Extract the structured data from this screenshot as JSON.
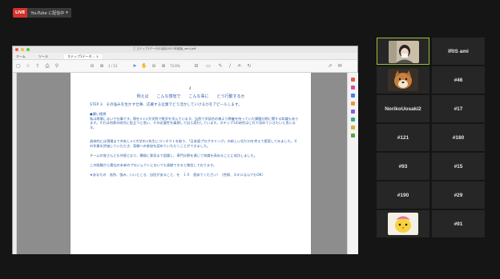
{
  "live_badge": {
    "label": "LIVE",
    "text": "YouTube に配信中",
    "caret": "▾"
  },
  "window": {
    "title": "□ ステップ1データの活用/2023年度版_ver4.pdf",
    "tabs": [
      "ホーム",
      "ツール",
      "ステップ1データ… ×"
    ],
    "page_indicator": "1 / 12",
    "zoom": "73.6%"
  },
  "document": {
    "page_mark": "4",
    "heading": "例えば　　こんな感覚で　　こんな事に　　どう行動するか",
    "step_line": "STEP 3　その強みを生かす仕事、応募する企業でどう活かしていけるかをアピールします。",
    "paragraph1": "●課い理想\n私は現場しないで仕事です。現在×××大学院で数学を学んでいます。当然で学部名の様より教養を持っていた課題分野に関する知識もあります。それは何県の研究に役立つと思い、その必要性を痛感して自ら実行しています。ステップ1の研究はこれで深めていきたいと思います。",
    "paragraph2": "具体的には現場まで共有し××大学の×先生にコンタクトを取り、「日本語プログラミング」の新しい切り口を考えて提案してみました。その作業を評価していただき、実験への参加を認めていただくことができました。",
    "paragraph3": "チームの皆さんとも共感となり、積極に意見まで認識し、専門分野を通じて知識を高めることに成功しました。",
    "paragraph4": "この経験から貴社の未来のプロジェクトにおいても貢献できると確信しております。",
    "paragraph5": "★あなたの　長所、強み、いいところ、自信があること、を　１０　個あてください！（性格、スキルなんでもOK）"
  },
  "participants": [
    {
      "name": "",
      "avatar": "person-video"
    },
    {
      "name": "IRIS ami"
    },
    {
      "name": "",
      "avatar": "dog-photo"
    },
    {
      "name": "#46"
    },
    {
      "name": "NorikoUosaki2"
    },
    {
      "name": "#17"
    },
    {
      "name": "#121"
    },
    {
      "name": "#180"
    },
    {
      "name": "#93"
    },
    {
      "name": "#15"
    },
    {
      "name": "#190"
    },
    {
      "name": "#29"
    },
    {
      "name": "",
      "avatar": "chick-character"
    },
    {
      "name": "#91"
    }
  ],
  "colors": {
    "live_red": "#d5312c",
    "active_speaker": "#9fc03a",
    "doc_text": "#2d5faa",
    "tile_bg": "#262626"
  }
}
